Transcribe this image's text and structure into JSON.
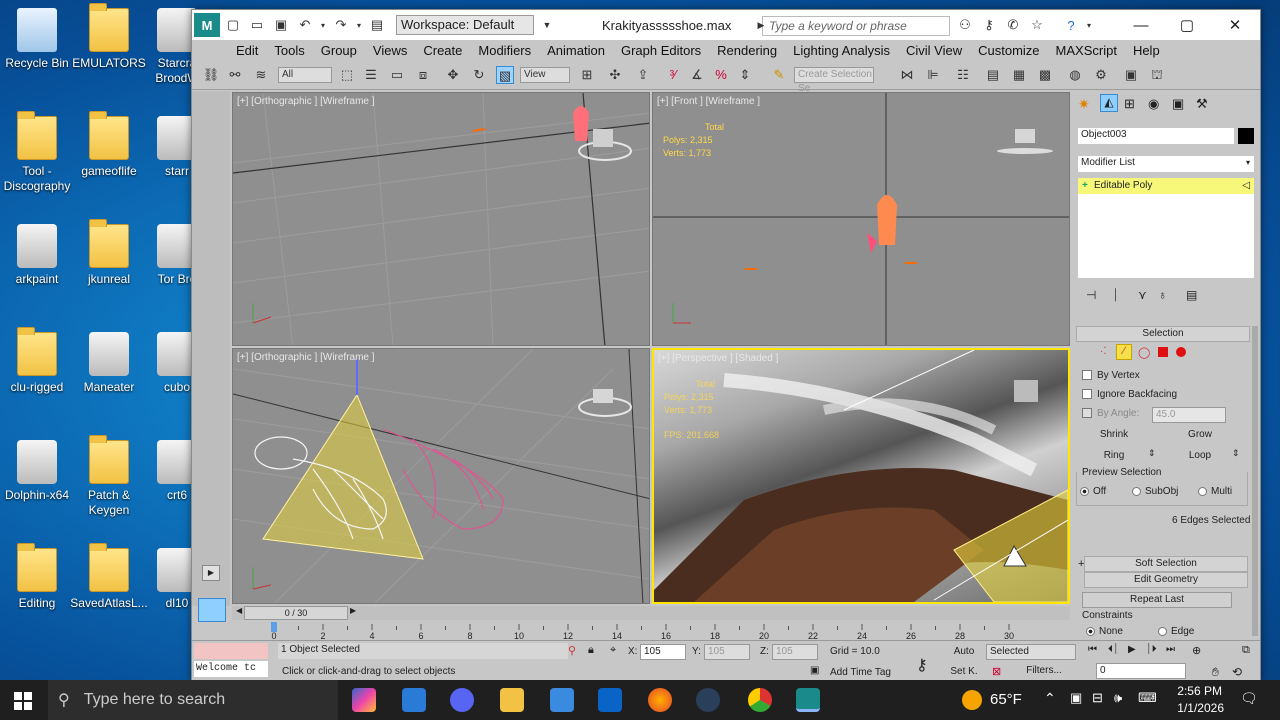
{
  "desktop": {
    "icons": [
      {
        "label": "Recycle Bin",
        "kind": "recycle"
      },
      {
        "label": "EMULATORS",
        "kind": "folder"
      },
      {
        "label": "Starcra\nBroodW",
        "kind": "app"
      },
      {
        "label": "Tool -\nDiscography",
        "kind": "folder"
      },
      {
        "label": "gameoflife",
        "kind": "folder"
      },
      {
        "label": "starr",
        "kind": "app"
      },
      {
        "label": "arkpaint",
        "kind": "app"
      },
      {
        "label": "jkunreal",
        "kind": "folder"
      },
      {
        "label": "Tor Bro",
        "kind": "app"
      },
      {
        "label": "clu-rigged",
        "kind": "folder"
      },
      {
        "label": "Maneater",
        "kind": "app"
      },
      {
        "label": "cubo",
        "kind": "app"
      },
      {
        "label": "Dolphin-x64",
        "kind": "app"
      },
      {
        "label": "Patch &\nKeygen",
        "kind": "folder"
      },
      {
        "label": "crt6",
        "kind": "app"
      },
      {
        "label": "Editing",
        "kind": "folder"
      },
      {
        "label": "SavedAtlasL...",
        "kind": "folder"
      },
      {
        "label": "dl10",
        "kind": "app"
      }
    ]
  },
  "window": {
    "workspace": "Workspace: Default",
    "title": "Krakityassssshoe.max",
    "search_placeholder": "Type a keyword or phrase",
    "menu": [
      "Edit",
      "Tools",
      "Group",
      "Views",
      "Create",
      "Modifiers",
      "Animation",
      "Graph Editors",
      "Rendering",
      "Lighting Analysis",
      "Civil View",
      "Customize",
      "MAXScript",
      "Help"
    ],
    "toolbar": {
      "filter": "All",
      "coord": "View",
      "selection_set": "Create Selection Se"
    }
  },
  "viewports": {
    "top_left": {
      "label": "[+] [Orthographic ] [Wireframe ]"
    },
    "top_right": {
      "label": "[+] [Front ] [Wireframe ]",
      "stats_title": "Total",
      "polys": "Polys:  2,315",
      "verts": "Verts:  1,773"
    },
    "bottom_left": {
      "label": "[+] [Orthographic ] [Wireframe ]"
    },
    "bottom_right": {
      "label": "[+] [Perspective ] [Shaded ]",
      "stats_title": "Total",
      "polys": "Polys:  2,315",
      "verts": "Verts:  1,773",
      "fps": "FPS:     201.668"
    }
  },
  "command_panel": {
    "object_name": "Object003",
    "modifier_list": "Modifier List",
    "stack_item": "Editable Poly",
    "selection_title": "Selection",
    "by_vertex": "By Vertex",
    "ignore_backfacing": "Ignore Backfacing",
    "by_angle": "By Angle:",
    "angle_value": "45.0",
    "shrink": "Shrink",
    "grow": "Grow",
    "ring": "Ring",
    "loop": "Loop",
    "preview_title": "Preview Selection",
    "preview_off": "Off",
    "preview_subobj": "SubObj",
    "preview_multi": "Multi",
    "selected_count": "6 Edges Selected",
    "soft_selection": "Soft Selection",
    "edit_geometry": "Edit Geometry",
    "repeat_last": "Repeat Last",
    "constraints": "Constraints",
    "none": "None",
    "edge": "Edge"
  },
  "timeline": {
    "frame_range": "0 / 30",
    "ticks": [
      "0",
      "2",
      "4",
      "6",
      "8",
      "10",
      "12",
      "14",
      "16",
      "18",
      "20",
      "22",
      "24",
      "26",
      "28",
      "30"
    ]
  },
  "status": {
    "script_box": "Welcome tc",
    "selected": "1 Object Selected",
    "prompt": "Click or click-and-drag to select objects",
    "x_label": "X:",
    "x": "105",
    "y_label": "Y:",
    "y": "105",
    "z_label": "Z:",
    "z": "105",
    "grid": "Grid = 10.0",
    "add_time_tag": "Add Time Tag",
    "auto": "Auto",
    "set_k": "Set K.",
    "key_filter": "Selected",
    "filters": "Filters...",
    "frame": "0"
  },
  "taskbar": {
    "search": "Type here to search",
    "weather": "65°F",
    "time": "2:56 PM",
    "date": "1/1/2026"
  },
  "colors": {
    "accent": "#ffe600",
    "desktop": "#0e76bf",
    "ui_gray": "#c7c7c7"
  }
}
